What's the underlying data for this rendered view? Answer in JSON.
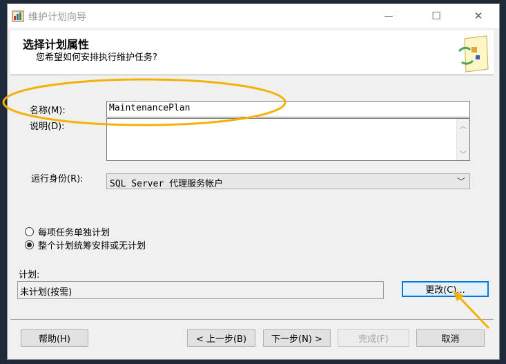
{
  "window": {
    "title": "维护计划向导"
  },
  "controls": {
    "minimize": "—",
    "maximize": "☐",
    "close": "✕"
  },
  "header": {
    "title": "选择计划属性",
    "subtitle": "您希望如何安排执行维护任务?"
  },
  "form": {
    "name_label": "名称(M):",
    "name_value": "MaintenancePlan",
    "desc_label": "说明(D):",
    "desc_value": "",
    "run_as_label": "运行身份(R):",
    "run_as_value": "SQL Server 代理服务帐户",
    "radio_separate": "每项任务单独计划",
    "radio_whole": "整个计划统筹安排或无计划",
    "selected_radio": "whole",
    "schedule_label": "计划:",
    "schedule_value": "未计划(按需)",
    "change_button": "更改(C)..."
  },
  "footer": {
    "help": "帮助(H)",
    "back": "< 上一步(B)",
    "next": "下一步(N) >",
    "finish": "完成(F)",
    "cancel": "取消"
  },
  "annotation_color": "#f5b000"
}
